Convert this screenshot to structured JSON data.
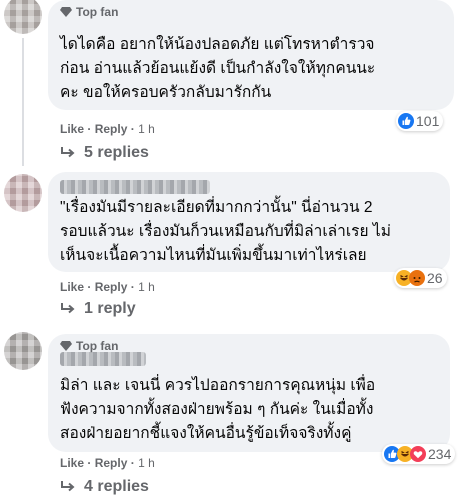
{
  "comments": [
    {
      "badge": "Top fan",
      "text": "ไดไดคือ อยากให้น้องปลอดภัย แต่โทรหาตำรวจ\nก่อน อ่านแล้วย้อนแย้งดี เป็นกำลังใจให้ทุกคนนะ\nคะ ขอให้ครอบครัวกลับมารักกัน",
      "like": "Like",
      "reply": "Reply",
      "time": "1 h",
      "reaction_count": "101",
      "reaction_icons": [
        "like-icon"
      ],
      "replies": "5 replies"
    },
    {
      "badge": "",
      "text": "\"เรื่องมันมีรายละเอียดที่มากกว่านั้น\" นี่อ่านวน 2\nรอบแล้วนะ เรื่องมันก็วนเหมือนกับที่มิล่าเล่าเรย ไม่\nเห็นจะเนื้อความไหนที่มันเพิ่มขึ้นมาเท่าไหร่เลย",
      "like": "Like",
      "reply": "Reply",
      "time": "1 h",
      "reaction_count": "26",
      "reaction_icons": [
        "haha-icon",
        "angry-icon"
      ],
      "replies": "1 reply"
    },
    {
      "badge": "Top fan",
      "text": "มิล่า และ เจนนี่ ควรไปออกรายการคุณหนุ่ม เพื่อ\nฟังความจากทั้งสองฝ่ายพร้อม ๆ กันค่ะ ในเมื่อทั้ง\nสองฝ่ายอยากชี้แจงให้คนอื่นรู้ข้อเท็จจริงทั้งคู่",
      "like": "Like",
      "reply": "Reply",
      "time": "1 h",
      "reaction_count": "234",
      "reaction_icons": [
        "like-icon",
        "haha-icon",
        "love-icon"
      ],
      "replies": "4 replies"
    }
  ],
  "separator": "·",
  "colors": {
    "bubble": "#f0f2f5",
    "meta": "#65676b",
    "text": "#050505",
    "like_blue": "#1877f2"
  }
}
